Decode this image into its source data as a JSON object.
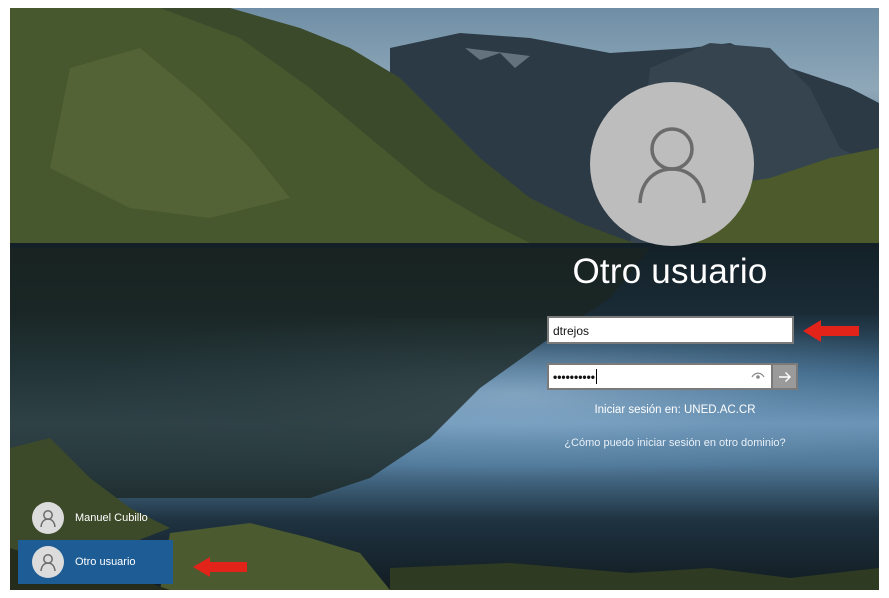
{
  "login": {
    "display_name": "Otro usuario",
    "username_value": "dtrejos",
    "password_mask": "••••••••••",
    "sign_in_to": "Iniciar sesión en: UNED.AC.CR",
    "other_domain_link": "¿Cómo puedo iniciar sesión en otro dominio?"
  },
  "user_list": [
    {
      "name": "Manuel Cubillo",
      "selected": false
    },
    {
      "name": "Otro usuario",
      "selected": true
    }
  ],
  "icons": {
    "avatar": "user-silhouette-icon",
    "reveal_password": "eye-icon",
    "submit": "arrow-right-icon",
    "annotation": "red-arrow-icon"
  },
  "colors": {
    "selected_tile": "#1e5c96",
    "annotation_arrow": "#e2231a",
    "avatar_bg": "#bdbdbd"
  }
}
